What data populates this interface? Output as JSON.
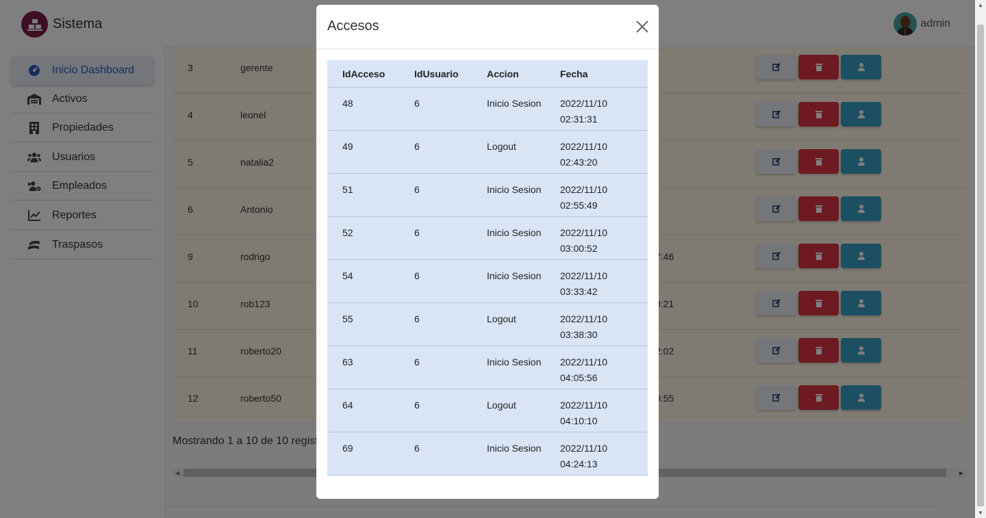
{
  "app": {
    "brand": "Sistema",
    "user": "admin"
  },
  "sidebar": {
    "items": [
      {
        "label": "Inicio Dashboard",
        "icon": "dashboard-icon",
        "active": true
      },
      {
        "label": "Activos",
        "icon": "warehouse-icon"
      },
      {
        "label": "Propiedades",
        "icon": "building-icon"
      },
      {
        "label": "Usuarios",
        "icon": "users-icon"
      },
      {
        "label": "Empleados",
        "icon": "users-cog-icon"
      },
      {
        "label": "Reportes",
        "icon": "chart-line-icon"
      },
      {
        "label": "Traspasos",
        "icon": "hand-money-icon"
      }
    ]
  },
  "main": {
    "rows": [
      {
        "id": "3",
        "user": "gerente",
        "time": ""
      },
      {
        "id": "4",
        "user": "leonel",
        "time": ""
      },
      {
        "id": "5",
        "user": "natalia2",
        "time": ""
      },
      {
        "id": "6",
        "user": "Antonio",
        "time": ""
      },
      {
        "id": "9",
        "user": "rodrigo",
        "time": "7:46"
      },
      {
        "id": "10",
        "user": "rob123",
        "time": "9:21"
      },
      {
        "id": "11",
        "user": "roberto20",
        "time": "2:02"
      },
      {
        "id": "12",
        "user": "roberto50",
        "time": "0:55"
      }
    ],
    "showing": "Mostrando 1 a 10 de 10 regist"
  },
  "modal": {
    "title": "Accesos",
    "columns": [
      "IdAcceso",
      "IdUsuario",
      "Accion",
      "Fecha"
    ],
    "rows": [
      {
        "id": "48",
        "user": "6",
        "action": "Inicio Sesion",
        "date": "2022/11/10 02:31:31"
      },
      {
        "id": "49",
        "user": "6",
        "action": "Logout",
        "date": "2022/11/10 02:43:20"
      },
      {
        "id": "51",
        "user": "6",
        "action": "Inicio Sesion",
        "date": "2022/11/10 02:55:49"
      },
      {
        "id": "52",
        "user": "6",
        "action": "Inicio Sesion",
        "date": "2022/11/10 03:00:52"
      },
      {
        "id": "54",
        "user": "6",
        "action": "Inicio Sesion",
        "date": "2022/11/10 03:33:42"
      },
      {
        "id": "55",
        "user": "6",
        "action": "Logout",
        "date": "2022/11/10 03:38:30"
      },
      {
        "id": "63",
        "user": "6",
        "action": "Inicio Sesion",
        "date": "2022/11/10 04:05:56"
      },
      {
        "id": "64",
        "user": "6",
        "action": "Logout",
        "date": "2022/11/10 04:10:10"
      },
      {
        "id": "69",
        "user": "6",
        "action": "Inicio Sesion",
        "date": "2022/11/10 04:24:13"
      }
    ]
  },
  "colors": {
    "brand": "#7a1f4a",
    "danger": "#dc3545",
    "info": "#3a9fc4",
    "active_nav": "#2d5cb8",
    "modal_table": "#d9e4f4"
  }
}
